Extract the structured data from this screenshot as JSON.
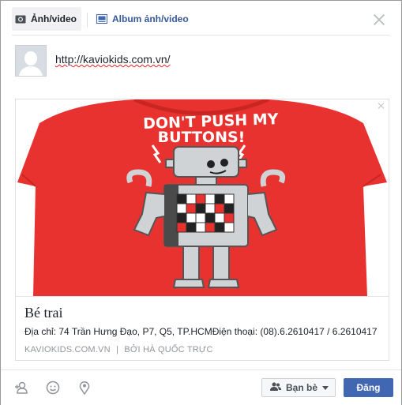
{
  "tabs": [
    {
      "label": "Ảnh/video",
      "icon": "camera-icon"
    },
    {
      "label": "Album ảnh/video",
      "icon": "album-icon"
    }
  ],
  "status": {
    "value": "http://kaviokids.com.vn/"
  },
  "link_preview": {
    "shirt_text_line1": "DON'T PUSH MY",
    "shirt_text_line2": "BUTTONS!",
    "title": "Bé trai",
    "description": "Địa chỉ: 74 Trần Hưng Đạo, P7, Q5, TP.HCMĐiện thoại:  (08).6.2610417 / 6.2610417",
    "domain": "KAVIOKIDS.COM.VN",
    "separator": "|",
    "provider": "BỞI HÀ QUỐC TRỰC"
  },
  "footer": {
    "audience_label": "Bạn bè",
    "post_label": "Đăng"
  },
  "colors": {
    "accent": "#4267b2",
    "shirt": "#e8322f"
  }
}
